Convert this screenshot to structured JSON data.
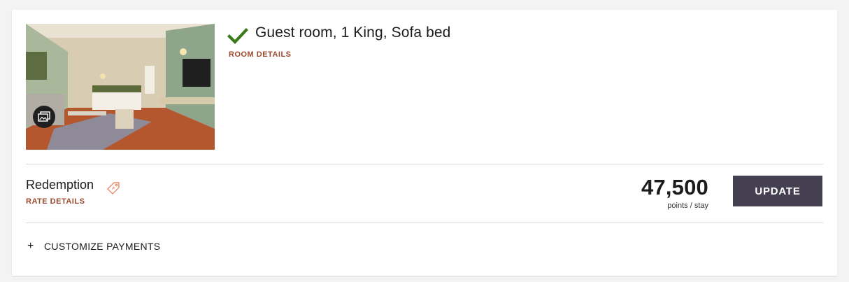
{
  "room": {
    "title": "Guest room, 1 King, Sofa bed",
    "details_link": "ROOM DETAILS",
    "photo": "hotel-room-photo",
    "gallery_icon": "photo-gallery-icon",
    "status_icon": "checkmark-icon"
  },
  "rate": {
    "name": "Redemption",
    "tag_icon": "price-tag-icon",
    "details_link": "RATE DETAILS",
    "points": "47,500",
    "points_unit": "points / stay",
    "update_label": "UPDATE"
  },
  "customize": {
    "icon": "plus-icon",
    "label": "CUSTOMIZE PAYMENTS"
  },
  "colors": {
    "accent_link": "#9c4a2f",
    "button_bg": "#453f52",
    "check": "#3a7a1a",
    "tag": "#e8784e"
  }
}
